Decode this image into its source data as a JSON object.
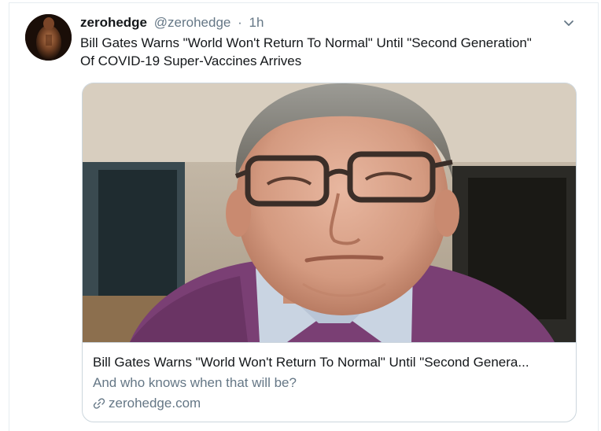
{
  "tweet": {
    "author_name": "zerohedge",
    "author_handle": "@zerohedge",
    "separator": "·",
    "time": "1h",
    "text_line1": "Bill Gates Warns \"World Won't Return To Normal\" Until \"Second Generation\"",
    "text_line2": "Of COVID-19 Super-Vaccines Arrives"
  },
  "icons": {
    "avatar": "avatar-image",
    "caret": "chevron-down-icon",
    "link": "link-icon"
  },
  "card": {
    "title": "Bill Gates Warns \"World Won't Return To Normal\" Until \"Second Genera...",
    "description": "And who knows when that will be?",
    "domain": "zerohedge.com"
  },
  "colors": {
    "text_primary": "#14171a",
    "text_secondary": "#657786",
    "border": "#ccd6dd",
    "divider": "#e6ecf0"
  }
}
